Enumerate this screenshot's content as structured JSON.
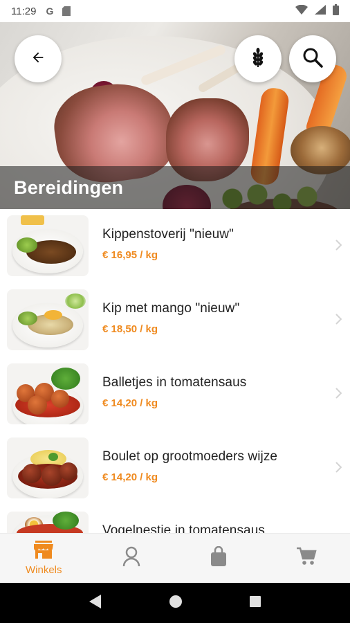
{
  "status_bar": {
    "time": "11:29"
  },
  "header": {
    "title": "Bereidingen"
  },
  "products": [
    {
      "name": "Kippenstoverij \"nieuw\"",
      "price": "€ 16,95 / kg"
    },
    {
      "name": "Kip met mango \"nieuw\"",
      "price": "€ 18,50 / kg"
    },
    {
      "name": "Balletjes in tomatensaus",
      "price": "€ 14,20 / kg"
    },
    {
      "name": "Boulet op grootmoeders wijze",
      "price": "€ 14,20 / kg"
    },
    {
      "name": "Vogelnestje in tomatensaus",
      "price": ""
    }
  ],
  "bottom_nav": {
    "items": [
      {
        "label": "Winkels",
        "icon": "store-icon",
        "active": true
      },
      {
        "icon": "user-icon"
      },
      {
        "icon": "bag-icon"
      },
      {
        "icon": "cart-icon"
      }
    ]
  },
  "colors": {
    "accent": "#ef8a1f",
    "inactive_icon": "#8a8a8a",
    "title_text": "#ffffff",
    "item_text": "#222222"
  }
}
